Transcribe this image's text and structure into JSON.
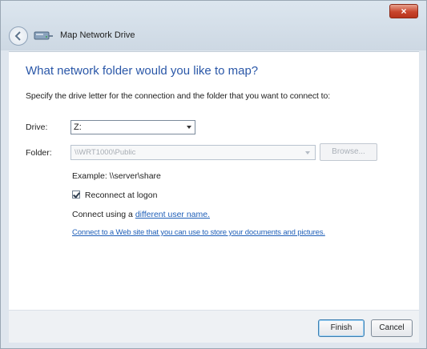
{
  "window": {
    "title": "Map Network Drive",
    "close_label": "×"
  },
  "main": {
    "heading": "What network folder would you like to map?",
    "instruction": "Specify the drive letter for the connection and the folder that you want to connect to:",
    "drive": {
      "label": "Drive:",
      "value": "Z:"
    },
    "folder": {
      "label": "Folder:",
      "value": "\\\\WRT1000\\Public",
      "browse_label": "Browse..."
    },
    "example": "Example: \\\\server\\share",
    "reconnect": {
      "label": "Reconnect at logon",
      "checked": true
    },
    "connect_using": {
      "prefix": "Connect using a ",
      "link": "different user name."
    },
    "web_link": "Connect to a Web site that you can use to store your documents and pictures."
  },
  "footer": {
    "finish_label": "Finish",
    "cancel_label": "Cancel"
  }
}
